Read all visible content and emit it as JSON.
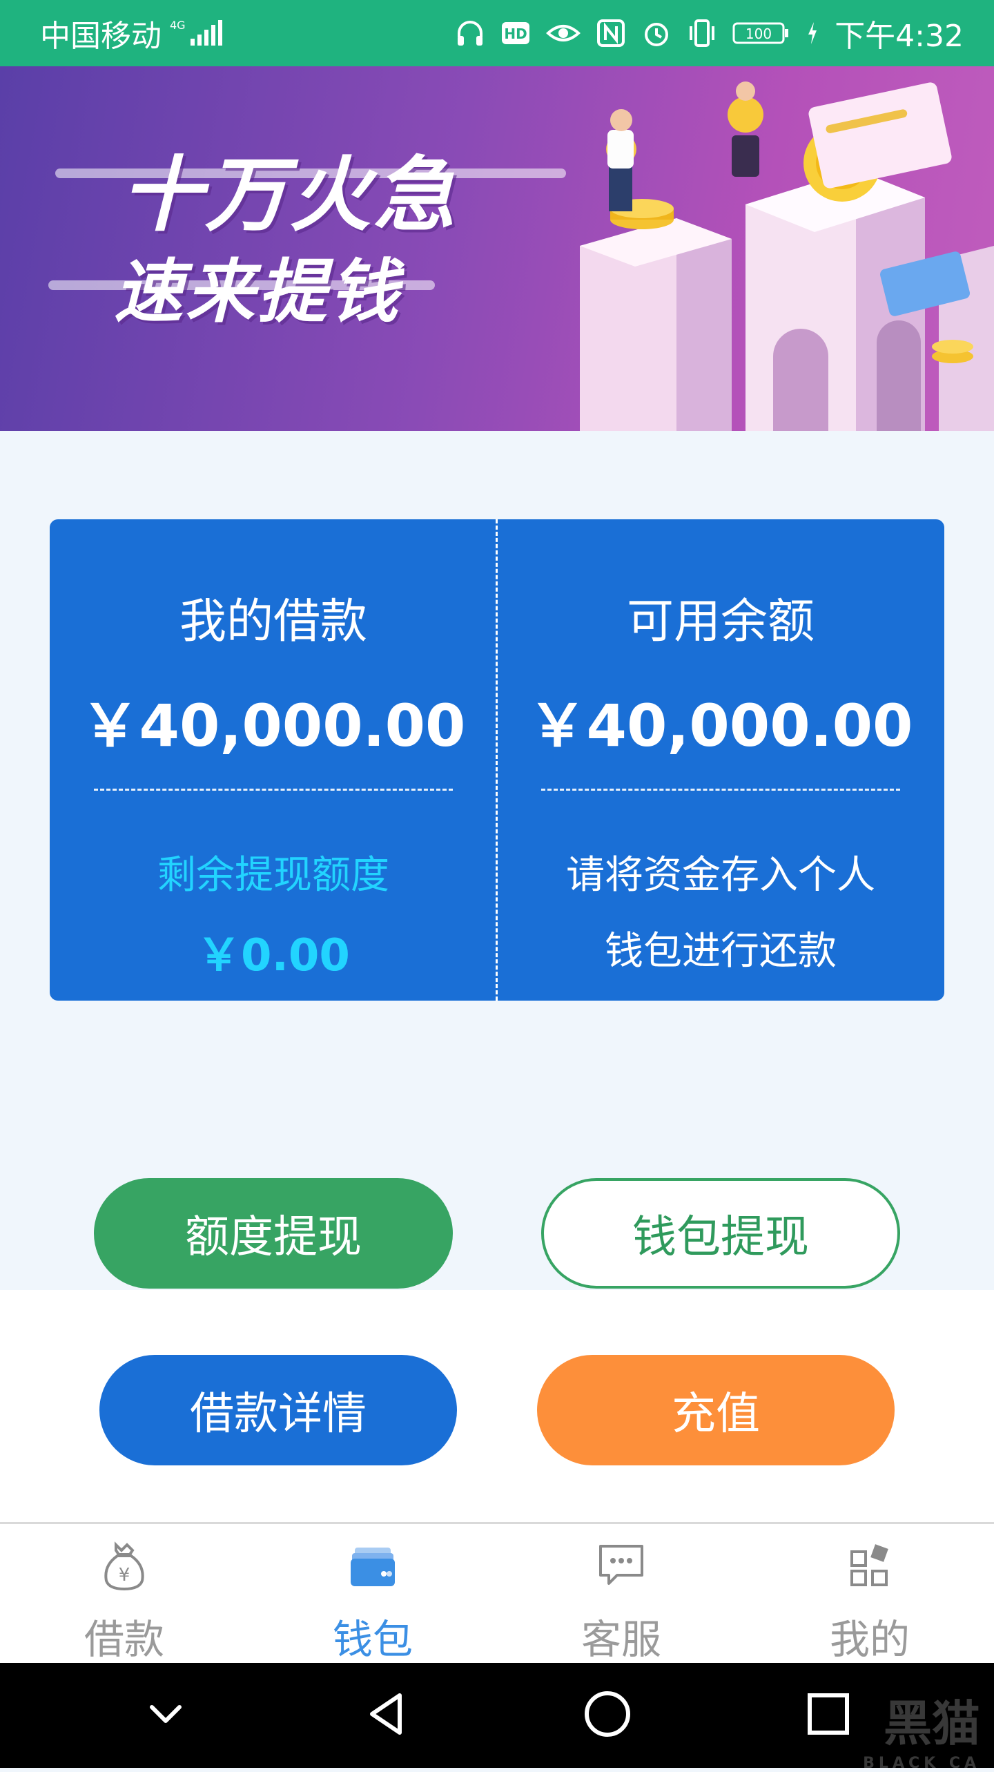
{
  "status_bar": {
    "carrier": "中国移动",
    "network": "4G",
    "battery": "100",
    "time": "下午4:32",
    "icons": [
      "signal-icon",
      "headphone-icon",
      "hd-icon",
      "eye-icon",
      "nfc-icon",
      "alarm-icon",
      "vibrate-icon",
      "battery-icon",
      "charging-icon"
    ]
  },
  "banner": {
    "line1": "十万火急",
    "line2": "速来提钱"
  },
  "card": {
    "left": {
      "title": "我的借款",
      "amount": "￥40,000.00",
      "sub_label": "剩余提现额度",
      "sub_amount": "￥0.00"
    },
    "right": {
      "title": "可用余额",
      "amount": "￥40,000.00",
      "note_line1": "请将资金存入个人",
      "note_line2": "钱包进行还款"
    }
  },
  "buttons": {
    "quota_withdraw": "额度提现",
    "wallet_withdraw": "钱包提现",
    "loan_details": "借款详情",
    "recharge": "充值"
  },
  "tabs": [
    {
      "label": "借款",
      "icon": "money-bag-icon",
      "active": false
    },
    {
      "label": "钱包",
      "icon": "wallet-icon",
      "active": true
    },
    {
      "label": "客服",
      "icon": "chat-icon",
      "active": false
    },
    {
      "label": "我的",
      "icon": "grid-icon",
      "active": false
    }
  ],
  "watermark": {
    "text": "黑猫",
    "sub": "BLACK CA"
  },
  "colors": {
    "status_bar": "#1fb37f",
    "card_blue": "#1a6fd6",
    "green": "#37a463",
    "orange": "#fd8f3a",
    "cyan": "#22d4ff",
    "tab_active": "#3b8fe4"
  }
}
